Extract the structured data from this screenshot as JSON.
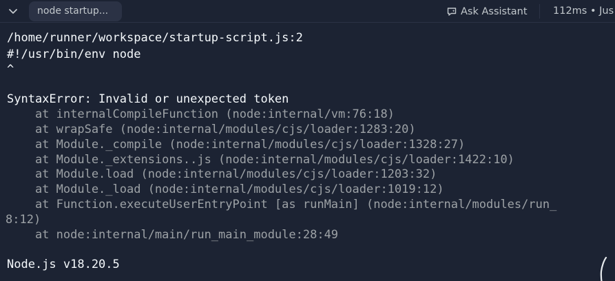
{
  "header": {
    "tab_label": "node startup...",
    "ask_assistant_label": "Ask Assistant",
    "timing_text": "112ms • Jus"
  },
  "console": {
    "lines": [
      "/home/runner/workspace/startup-script.js:2",
      "#!/usr/bin/env node",
      "^",
      "",
      "SyntaxError: Invalid or unexpected token",
      "    at internalCompileFunction (node:internal/vm:76:18)",
      "    at wrapSafe (node:internal/modules/cjs/loader:1283:20)",
      "    at Module._compile (node:internal/modules/cjs/loader:1328:27)",
      "    at Module._extensions..js (node:internal/modules/cjs/loader:1422:10)",
      "    at Module.load (node:internal/modules/cjs/loader:1203:32)",
      "    at Module._load (node:internal/modules/cjs/loader:1019:12)",
      "    at Function.executeUserEntryPoint [as runMain] (node:internal/modules/run_",
      "8:12)",
      "    at node:internal/main/run_main_module:28:49",
      "",
      "Node.js v18.20.5"
    ]
  },
  "icons": {
    "collapse": "chevron-down-icon",
    "assistant": "chat-bubble-icon"
  },
  "colors": {
    "background": "#1c2333",
    "pill": "#2b3245",
    "text_primary": "#f5f9fc",
    "text_dim": "#9da2a6",
    "header_text": "#c2c8cc"
  }
}
